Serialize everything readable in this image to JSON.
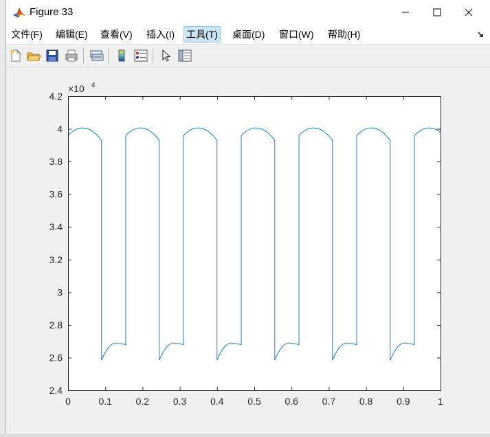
{
  "window": {
    "title": "Figure 33",
    "controls": {
      "minimize": "minimize",
      "maximize": "maximize",
      "close": "close"
    }
  },
  "menu": {
    "items": [
      {
        "label": "文件(F)"
      },
      {
        "label": "编辑(E)"
      },
      {
        "label": "查看(V)"
      },
      {
        "label": "插入(I)"
      },
      {
        "label": "工具(T)"
      },
      {
        "label": "桌面(D)"
      },
      {
        "label": "窗口(W)"
      },
      {
        "label": "帮助(H)"
      }
    ],
    "highlighted_index": 4
  },
  "toolbar": {
    "icons": [
      "new-figure-icon",
      "open-file-icon",
      "save-icon",
      "print-icon",
      "link-plot-icon",
      "colorbar-icon",
      "legend-icon",
      "edit-plot-arrow-icon",
      "property-inspector-icon"
    ]
  },
  "colors": {
    "line": "#0072bd",
    "axes_bg": "#ffffff",
    "figure_bg": "#f0f0f0",
    "menu_highlight": "#cce4f7"
  },
  "chart_data": {
    "type": "line",
    "title": "",
    "xlabel": "",
    "ylabel": "",
    "exponent_label": "×10",
    "exponent_power": "4",
    "xlim": [
      0,
      1
    ],
    "ylim": [
      2.4,
      4.2
    ],
    "grid": false,
    "x_ticks": [
      0,
      0.1,
      0.2,
      0.3,
      0.4,
      0.5,
      0.6,
      0.7,
      0.8,
      0.9,
      1
    ],
    "x_tick_labels": [
      "0",
      "0.1",
      "0.2",
      "0.3",
      "0.4",
      "0.5",
      "0.6",
      "0.7",
      "0.8",
      "0.9",
      "1"
    ],
    "y_ticks": [
      2.4,
      2.6,
      2.8,
      3.0,
      3.2,
      3.4,
      3.6,
      3.8,
      4.0,
      4.2
    ],
    "y_tick_labels": [
      "2.4",
      "2.6",
      "2.8",
      "3",
      "3.2",
      "3.4",
      "3.6",
      "3.8",
      "4",
      "4.2"
    ],
    "series": [
      {
        "color": "#0072bd",
        "period": 0.155,
        "high_duration": 0.09,
        "high_start": 3.96,
        "high_peak": 4.005,
        "high_end": 3.93,
        "low_start": 2.585,
        "low_plateau": 2.69,
        "low_end": 2.68,
        "first_cycle_high_start": 0.0
      }
    ]
  }
}
